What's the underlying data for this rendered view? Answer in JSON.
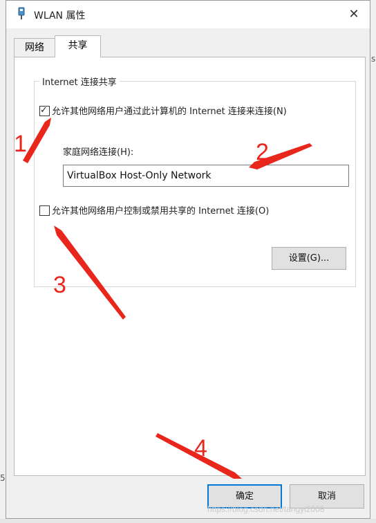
{
  "window": {
    "title": "WLAN 属性",
    "close_glyph": "✕",
    "icon": "network-adapter-icon"
  },
  "tabs": [
    {
      "label": "网络"
    },
    {
      "label": "共享"
    }
  ],
  "sharing": {
    "group_title": "Internet 连接共享",
    "allow_sharing_label": "允许其他网络用户通过此计算机的 Internet 连接来连接(N)",
    "allow_sharing_checked": true,
    "home_network_label": "家庭网络连接(H):",
    "home_network_value": "VirtualBox Host-Only Network",
    "allow_control_label": "允许其他网络用户控制或禁用共享的 Internet 连接(O)",
    "allow_control_checked": false,
    "settings_button": "设置(G)..."
  },
  "footer": {
    "ok_button": "确定",
    "cancel_button": "取消"
  },
  "annotations": {
    "numbers": [
      "1",
      "2",
      "3",
      "4"
    ],
    "color": "#e8261c"
  },
  "watermark": "https://blog.csdn.net/tangyi2008",
  "stray_text": {
    "left_bottom": "5",
    "right_top": "s（"
  }
}
